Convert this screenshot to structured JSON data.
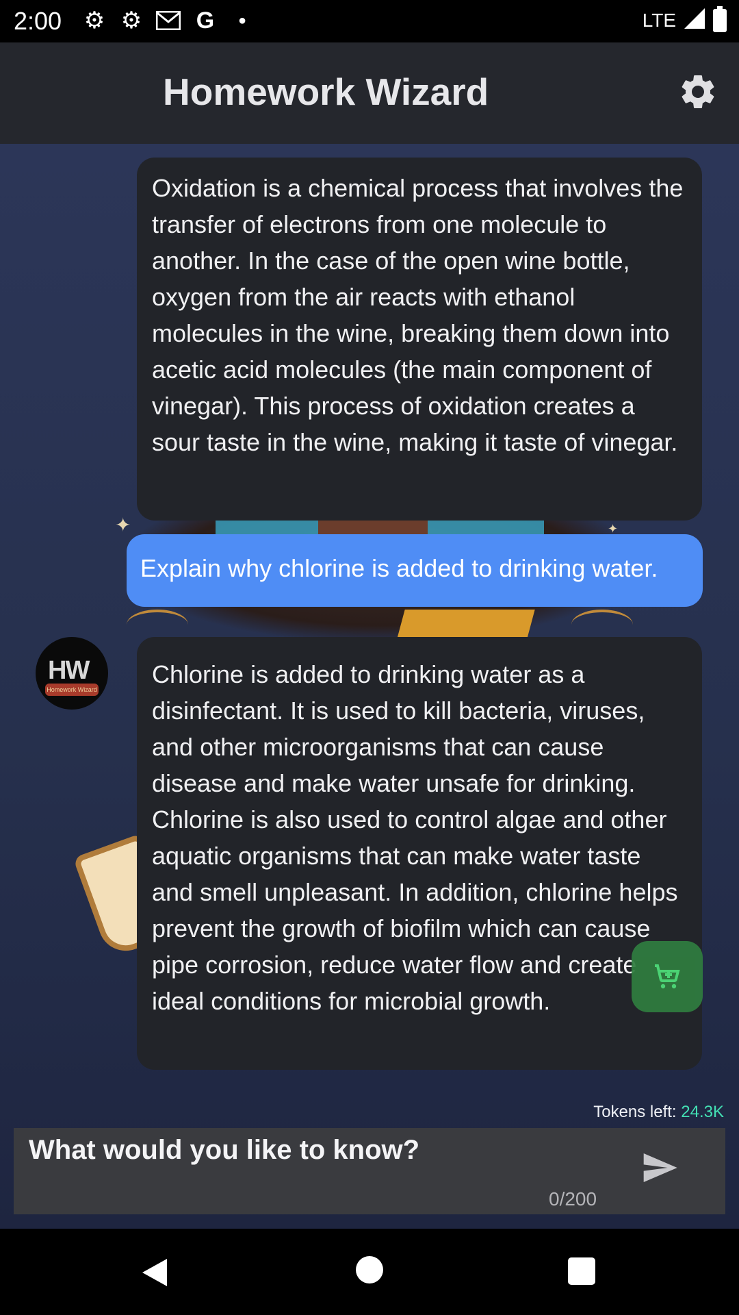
{
  "status_bar": {
    "time": "2:00",
    "network": "LTE",
    "icons": [
      "settings-icon",
      "settings-icon",
      "gmail-icon",
      "google-icon",
      "dot-icon",
      "signal-icon",
      "battery-icon"
    ]
  },
  "app_bar": {
    "title": "Homework Wizard",
    "settings_icon": "gear-icon"
  },
  "messages": [
    {
      "role": "assistant",
      "text": "Oxidation is a chemical process that involves the transfer of electrons from one molecule to another. In the case of the open wine bottle, oxygen from the air reacts with ethanol molecules in the wine, breaking them down into acetic acid molecules (the main component of vinegar). This process of oxidation creates a sour taste in the wine, making it taste of vinegar."
    },
    {
      "role": "user",
      "text": "Explain why chlorine is added to drinking water."
    },
    {
      "role": "assistant",
      "text": "Chlorine is added to drinking water as a disinfectant. It is used to kill bacteria, viruses, and other microorganisms that can cause disease and make water unsafe for drinking. Chlorine is also used to control algae and other aquatic organisms that can make water taste and smell unpleasant. In addition, chlorine helps prevent the growth of biofilm which can cause pipe corrosion, reduce water flow and create ideal conditions for microbial growth."
    }
  ],
  "avatar": {
    "monogram": "HW",
    "ribbon": "Homework Wizard"
  },
  "tokens": {
    "label": "Tokens left:",
    "value": "24.3K"
  },
  "input": {
    "placeholder": "What would you like to know?",
    "counter": "0/200"
  },
  "colors": {
    "user_bubble": "#4f8df5",
    "bot_bubble": "#222429",
    "token_accent": "#43e0b4",
    "cart_fab": "#2f7d3f"
  }
}
